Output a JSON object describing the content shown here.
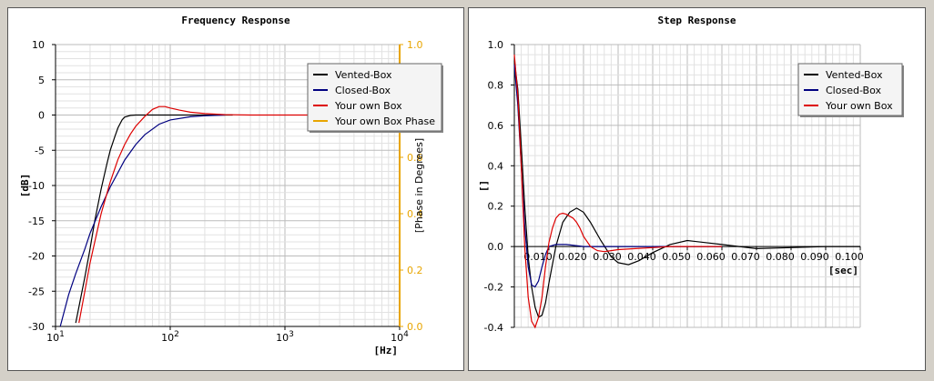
{
  "chart_data": [
    {
      "type": "line",
      "title": "Frequency Response",
      "xlabel": "[Hz]",
      "ylabel": "[dB]",
      "ylabel_right": "[Phase in Degrees]",
      "xscale": "log",
      "xlim": [
        10,
        10000
      ],
      "ylim": [
        -30,
        10
      ],
      "ylim_right": [
        0,
        1
      ],
      "xticks": [
        "10^1",
        "10^2",
        "10^3",
        "10^4"
      ],
      "yticks": [
        "10",
        "5",
        "0",
        "-5",
        "-10",
        "-15",
        "-20",
        "-25",
        "-30"
      ],
      "yticks_right": [
        "1.0",
        "0.8",
        "0.6",
        "0.4",
        "0.2",
        "0.0"
      ],
      "grid": true,
      "legend_position": "top-right",
      "series": [
        {
          "name": "Vented-Box",
          "color": "#000000",
          "x": [
            15,
            18,
            20,
            22,
            25,
            28,
            30,
            33,
            35,
            38,
            40,
            45,
            50,
            60,
            80,
            100,
            150,
            200,
            300,
            350
          ],
          "y": [
            -29.5,
            -23,
            -19,
            -15,
            -10.5,
            -7,
            -5,
            -3,
            -1.8,
            -0.7,
            -0.3,
            -0.05,
            0,
            0,
            0,
            0,
            0,
            0,
            0,
            0
          ]
        },
        {
          "name": "Closed-Box",
          "color": "#000080",
          "x": [
            11,
            13,
            15,
            18,
            20,
            25,
            30,
            40,
            50,
            60,
            80,
            100,
            150,
            200,
            300
          ],
          "y": [
            -30,
            -25.5,
            -22.5,
            -19,
            -16.8,
            -13,
            -10.2,
            -6.4,
            -4.2,
            -2.8,
            -1.3,
            -0.7,
            -0.25,
            -0.1,
            0
          ]
        },
        {
          "name": "Your own Box",
          "color": "#dd0000",
          "x": [
            16,
            18,
            20,
            22,
            25,
            30,
            35,
            40,
            45,
            50,
            60,
            70,
            80,
            90,
            100,
            120,
            150,
            200,
            300,
            500,
            1000,
            2000,
            3000
          ],
          "y": [
            -29.5,
            -25,
            -21,
            -18,
            -14,
            -9.5,
            -6.3,
            -4.2,
            -2.7,
            -1.6,
            -0.2,
            0.8,
            1.2,
            1.2,
            1,
            0.7,
            0.4,
            0.2,
            0.05,
            0,
            0,
            0,
            0
          ]
        },
        {
          "name": "Your own Box Phase",
          "color": "#e8a500",
          "x": [],
          "y": []
        }
      ]
    },
    {
      "type": "line",
      "title": "Step Response",
      "xlabel": "[sec]",
      "ylabel": "[]",
      "xlim": [
        0,
        0.1
      ],
      "ylim": [
        -0.4,
        1
      ],
      "xticks": [
        "0.010",
        "0.020",
        "0.030",
        "0.040",
        "0.050",
        "0.060",
        "0.070",
        "0.080",
        "0.090",
        "0.100"
      ],
      "yticks": [
        "1.0",
        "0.8",
        "0.6",
        "0.4",
        "0.2",
        "0.0",
        "-0.2",
        "-0.4"
      ],
      "grid": true,
      "legend_position": "top-right",
      "series": [
        {
          "name": "Vented-Box",
          "color": "#000000",
          "x": [
            0,
            0.001,
            0.002,
            0.003,
            0.004,
            0.005,
            0.006,
            0.007,
            0.008,
            0.009,
            0.01,
            0.012,
            0.014,
            0.016,
            0.018,
            0.02,
            0.022,
            0.025,
            0.028,
            0.03,
            0.033,
            0.036,
            0.04,
            0.045,
            0.05,
            0.055,
            0.06,
            0.065,
            0.07,
            0.08,
            0.09,
            0.1
          ],
          "y": [
            0.92,
            0.78,
            0.5,
            0.2,
            -0.05,
            -0.2,
            -0.3,
            -0.35,
            -0.34,
            -0.28,
            -0.18,
            0.0,
            0.12,
            0.17,
            0.19,
            0.17,
            0.12,
            0.03,
            -0.05,
            -0.08,
            -0.09,
            -0.07,
            -0.03,
            0.01,
            0.03,
            0.02,
            0.01,
            0.0,
            -0.01,
            -0.005,
            0.0,
            0.0
          ]
        },
        {
          "name": "Closed-Box",
          "color": "#000080",
          "x": [
            0,
            0.001,
            0.002,
            0.003,
            0.004,
            0.005,
            0.006,
            0.007,
            0.008,
            0.009,
            0.01,
            0.012,
            0.015,
            0.02,
            0.025,
            0.03,
            0.04,
            0.05,
            0.06
          ],
          "y": [
            0.9,
            0.7,
            0.4,
            0.1,
            -0.1,
            -0.19,
            -0.2,
            -0.17,
            -0.1,
            -0.04,
            0.0,
            0.01,
            0.01,
            0.0,
            0.0,
            0.0,
            0.0,
            0.0,
            0.0
          ]
        },
        {
          "name": "Your own Box",
          "color": "#dd0000",
          "x": [
            0,
            0.001,
            0.002,
            0.003,
            0.004,
            0.005,
            0.006,
            0.007,
            0.008,
            0.009,
            0.01,
            0.011,
            0.012,
            0.013,
            0.014,
            0.015,
            0.016,
            0.017,
            0.018,
            0.019,
            0.02,
            0.022,
            0.024,
            0.026,
            0.028,
            0.03,
            0.035,
            0.04,
            0.045,
            0.05,
            0.06
          ],
          "y": [
            0.95,
            0.75,
            0.4,
            0.0,
            -0.25,
            -0.37,
            -0.4,
            -0.35,
            -0.25,
            -0.1,
            0.02,
            0.09,
            0.14,
            0.16,
            0.165,
            0.16,
            0.15,
            0.14,
            0.12,
            0.09,
            0.05,
            0.0,
            -0.02,
            -0.025,
            -0.02,
            -0.015,
            -0.01,
            -0.005,
            0.0,
            0.0,
            0.0
          ]
        }
      ]
    }
  ]
}
